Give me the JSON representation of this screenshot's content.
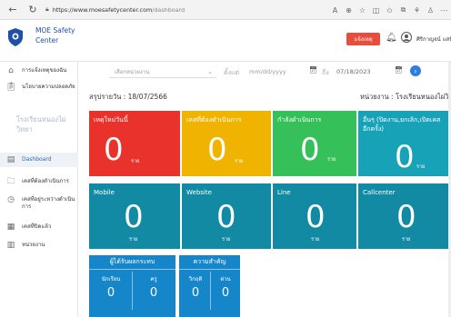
{
  "browser": {
    "url_host": "https://www.moesafetycenter.com",
    "url_path": "/dashboard"
  },
  "header": {
    "brand_line1": "MOE Safety",
    "brand_line2": "Center",
    "notify_label": "แจ้งเหตุ",
    "user_name": "ศิริกาญจน์ แสนิตวงศ์ ณ อยุธ"
  },
  "sidebar": {
    "items": [
      {
        "label": "การแจ้งเหตุของฉัน",
        "icon": "home-icon"
      },
      {
        "label": "นโยบายความปลอดภัย",
        "icon": "clipboard-icon"
      },
      {
        "label": "Dashboard",
        "icon": "dashboard-icon"
      },
      {
        "label": "เคสที่ต้องดำเนินการ",
        "icon": "folder-icon"
      },
      {
        "label": "เคสที่อยู่ระหว่างดำเนินการ",
        "icon": "clock-icon"
      },
      {
        "label": "เคสที่ปิดแล้ว",
        "icon": "archive-icon"
      },
      {
        "label": "หน่วยงาน",
        "icon": "building-icon"
      }
    ],
    "school_faded": "โรงเรียนหนองไผ่วิทยา"
  },
  "filter": {
    "agency_placeholder": "เลือกหน่วยงาน",
    "from_label": "ตั้งแต่",
    "from_placeholder": "mm/dd/yyyy",
    "to_label": "ถึง",
    "to_value": "07/18/2023"
  },
  "summary": {
    "date_text": "สรุปรายวัน : 18/07/2566",
    "agency_text": "หน่วยงาน : โรงเรียนหนองไผ่วิทยา"
  },
  "cards_top": [
    {
      "title": "เหตุใหม่วันนี้",
      "value": "0",
      "unit": "ราย",
      "color": "#e8322b"
    },
    {
      "title": "เคสที่ต้องดำเนินการ",
      "value": "0",
      "unit": "ราย",
      "color": "#f0b400"
    },
    {
      "title": "กำลังดำเนินการ",
      "value": "0",
      "unit": "ราย",
      "color": "#36c05a"
    },
    {
      "title": "อื่นๆ (ปิดงาน,ยกเลิก,เปิดเคสอีกครั้ง)",
      "value": "0",
      "unit": "ราย",
      "color": "#17a2b8"
    }
  ],
  "cards_mid": [
    {
      "title": "Mobile",
      "value": "0",
      "unit": "ราย",
      "color": "#138aa4"
    },
    {
      "title": "Website",
      "value": "0",
      "unit": "ราย",
      "color": "#138aa4"
    },
    {
      "title": "Line",
      "value": "0",
      "unit": "ราย",
      "color": "#138aa4"
    },
    {
      "title": "Callcenter",
      "value": "0",
      "unit": "ราย",
      "color": "#138aa4"
    }
  ],
  "victims": {
    "title": "ผู้ได้รับผลกระทบ",
    "a_label": "นักเรียน",
    "a_value": "0",
    "b_label": "ครู",
    "b_value": "0"
  },
  "severity": {
    "title": "ความสำคัญ",
    "a_label": "วิกฤติ",
    "a_value": "0",
    "b_label": "ด่วน",
    "b_value": "0"
  }
}
